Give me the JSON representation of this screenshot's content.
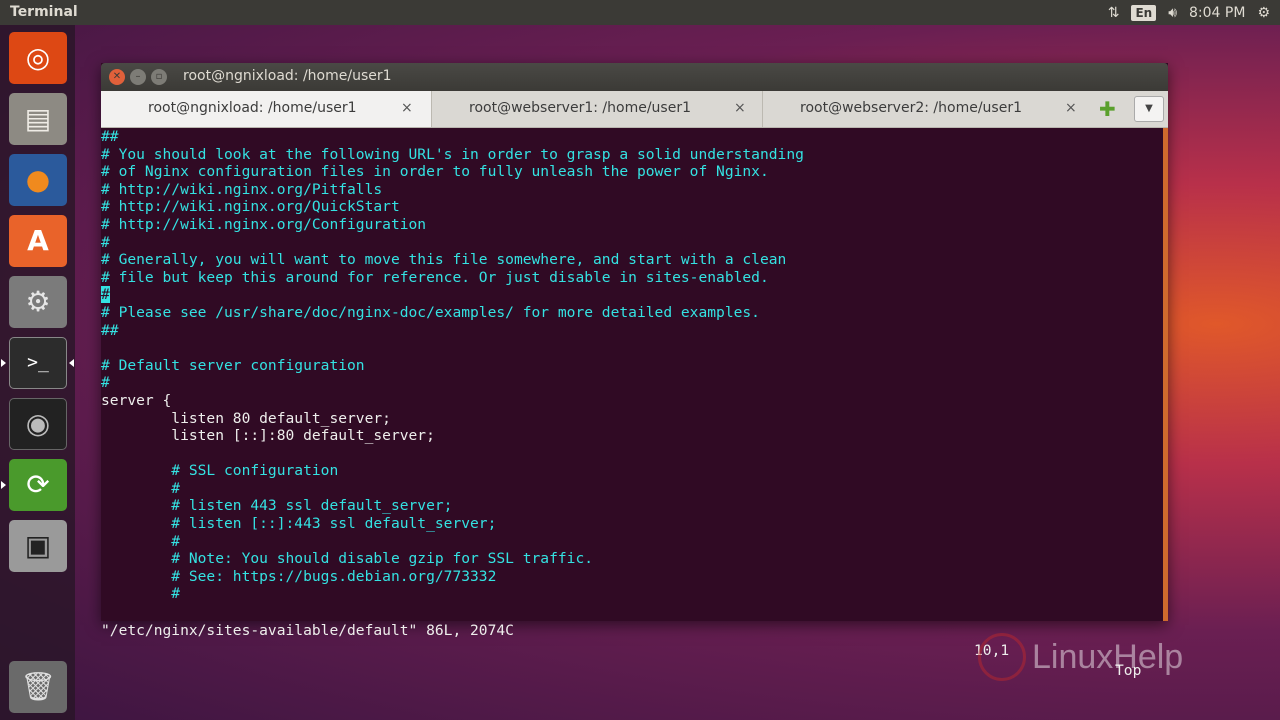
{
  "top_panel": {
    "app_title": "Terminal",
    "keyboard_layout": "En",
    "clock": "8:04 PM",
    "icons": [
      "network-transfer-icon",
      "volume-icon",
      "power-gear-icon"
    ]
  },
  "launcher": {
    "items": [
      {
        "name": "ubuntu-dash",
        "icon": "ubuntu-logo-icon",
        "color": "#dd4814"
      },
      {
        "name": "files",
        "icon": "file-cabinet-icon",
        "color": "#cfc9bd"
      },
      {
        "name": "firefox",
        "icon": "firefox-icon",
        "color": "#e8701a"
      },
      {
        "name": "software-center",
        "icon": "shopping-bag-icon",
        "color": "#e9632a"
      },
      {
        "name": "system-settings",
        "icon": "settings-wrench-icon",
        "color": "#b9b9b9"
      },
      {
        "name": "terminal",
        "icon": "terminal-icon",
        "color": "#3a3a3a"
      },
      {
        "name": "disk-utility",
        "icon": "safe-icon",
        "color": "#2f2f2f"
      },
      {
        "name": "software-updater",
        "icon": "updater-icon",
        "color": "#4a9a2c"
      },
      {
        "name": "save-disk",
        "icon": "floppy-disk-icon",
        "color": "#dcdcdc"
      },
      {
        "name": "trash",
        "icon": "trash-icon",
        "color": "#c9c9c9"
      }
    ]
  },
  "window": {
    "title": "root@ngnixload: /home/user1",
    "tabs": [
      {
        "label": "root@ngnixload: /home/user1",
        "close": "×",
        "active": true
      },
      {
        "label": "root@webserver1: /home/user1",
        "close": "×",
        "active": false
      },
      {
        "label": "root@webserver2: /home/user1",
        "close": "×",
        "active": false
      }
    ],
    "add_tab": "✚",
    "tab_menu": "▼"
  },
  "terminal": {
    "lines": [
      {
        "text": "##",
        "color": "cyan"
      },
      {
        "text": "# You should look at the following URL's in order to grasp a solid understanding",
        "color": "cyan"
      },
      {
        "text": "# of Nginx configuration files in order to fully unleash the power of Nginx.",
        "color": "cyan"
      },
      {
        "text": "# http://wiki.nginx.org/Pitfalls",
        "color": "cyan"
      },
      {
        "text": "# http://wiki.nginx.org/QuickStart",
        "color": "cyan"
      },
      {
        "text": "# http://wiki.nginx.org/Configuration",
        "color": "cyan"
      },
      {
        "text": "#",
        "color": "cyan"
      },
      {
        "text": "# Generally, you will want to move this file somewhere, and start with a clean",
        "color": "cyan"
      },
      {
        "text": "# file but keep this around for reference. Or just disable in sites-enabled.",
        "color": "cyan"
      },
      {
        "text": "#",
        "color": "cyan",
        "cursor": true
      },
      {
        "text": "# Please see /usr/share/doc/nginx-doc/examples/ for more detailed examples.",
        "color": "cyan"
      },
      {
        "text": "##",
        "color": "cyan"
      },
      {
        "text": "",
        "color": "white"
      },
      {
        "text": "# Default server configuration",
        "color": "cyan"
      },
      {
        "text": "#",
        "color": "cyan"
      },
      {
        "text": "server {",
        "color": "white"
      },
      {
        "text": "        listen 80 default_server;",
        "color": "white"
      },
      {
        "text": "        listen [::]:80 default_server;",
        "color": "white"
      },
      {
        "text": "",
        "color": "white"
      },
      {
        "text": "        # SSL configuration",
        "color": "cyan"
      },
      {
        "text": "        #",
        "color": "cyan"
      },
      {
        "text": "        # listen 443 ssl default_server;",
        "color": "cyan"
      },
      {
        "text": "        # listen [::]:443 ssl default_server;",
        "color": "cyan"
      },
      {
        "text": "        #",
        "color": "cyan"
      },
      {
        "text": "        # Note: You should disable gzip for SSL traffic.",
        "color": "cyan"
      },
      {
        "text": "        # See: https://bugs.debian.org/773332",
        "color": "cyan"
      },
      {
        "text": "        #",
        "color": "cyan"
      }
    ],
    "status": {
      "file": "\"/etc/nginx/sites-available/default\" 86L, 2074C",
      "position": "10,1",
      "scroll": "Top"
    }
  },
  "watermark": {
    "text": "LinuxHelp"
  },
  "colors": {
    "terminal_bg": "#300a24",
    "comment": "#34e2e2",
    "text": "#eeeeec",
    "panel": "#3b3a36"
  }
}
